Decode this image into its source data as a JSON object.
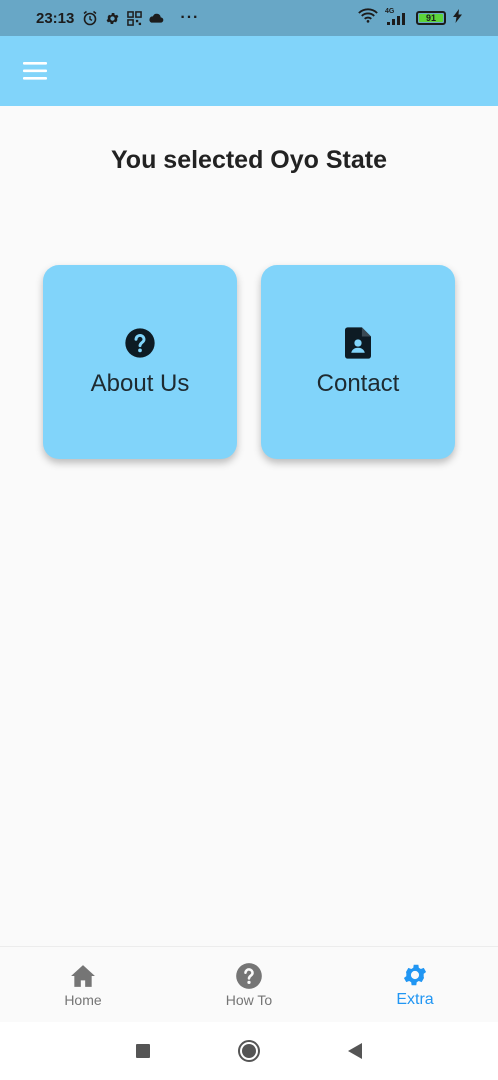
{
  "status_bar": {
    "time": "23:13",
    "more": "···",
    "network": "4G",
    "battery": "91",
    "icons": [
      "alarm-icon",
      "gear-icon",
      "qr-icon",
      "cloud-icon",
      "wifi-icon",
      "signal-icon",
      "battery-icon",
      "charging-icon"
    ]
  },
  "app_bar": {
    "menu_icon": "hamburger-menu-icon",
    "background": "#81d4fa"
  },
  "main": {
    "title": "You selected Oyo State",
    "cards": [
      {
        "label": "About Us",
        "icon": "help-circle-icon"
      },
      {
        "label": "Contact",
        "icon": "contact-document-icon"
      }
    ],
    "card_color": "#81d4fa"
  },
  "bottom_nav": {
    "items": [
      {
        "label": "Home",
        "icon": "home-icon",
        "active": false
      },
      {
        "label": "How To",
        "icon": "help-circle-icon",
        "active": false
      },
      {
        "label": "Extra",
        "icon": "gear-icon",
        "active": true
      }
    ],
    "active_color": "#2196f3",
    "inactive_color": "#757575"
  },
  "system_nav": {
    "buttons": [
      "recents-square-icon",
      "home-circle-icon",
      "back-triangle-icon"
    ]
  }
}
